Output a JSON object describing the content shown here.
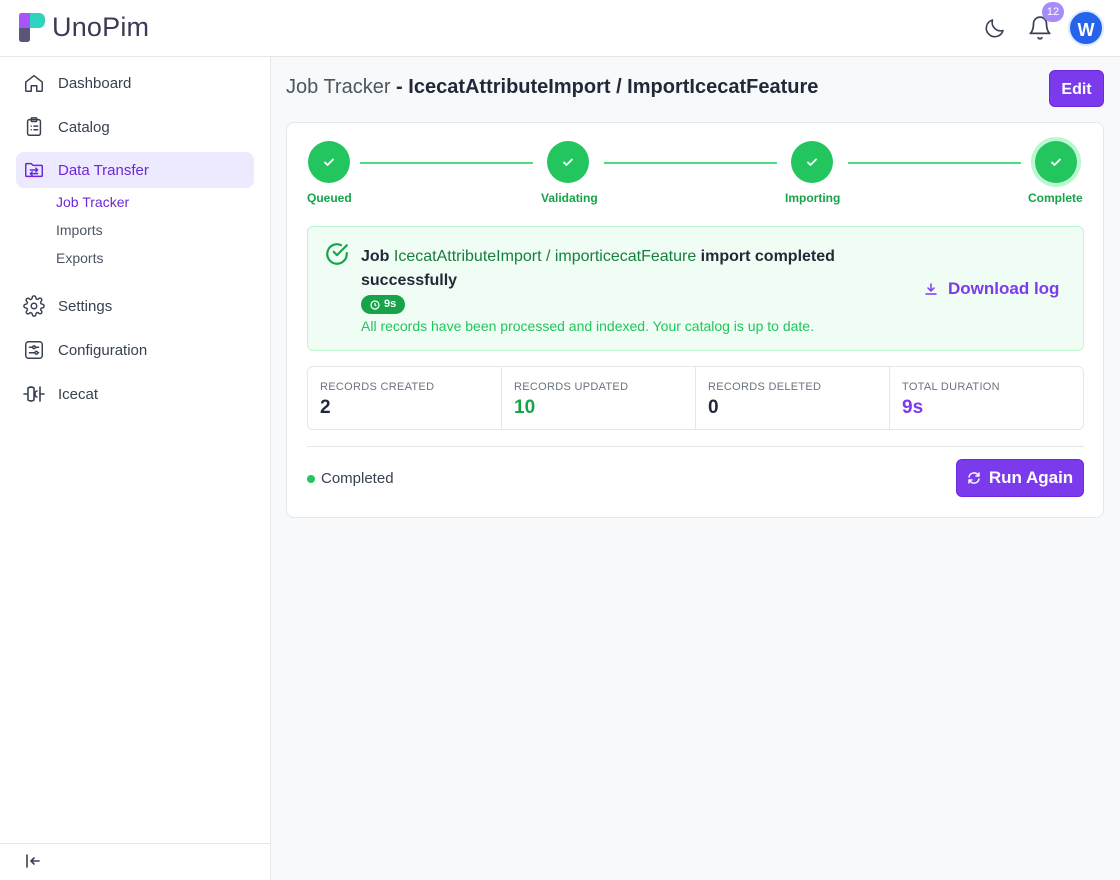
{
  "app": {
    "name": "UnoPim"
  },
  "header": {
    "notifications_count": "12",
    "avatar_initial": "W"
  },
  "sidebar": {
    "items": [
      {
        "label": "Dashboard",
        "icon": "home-icon"
      },
      {
        "label": "Catalog",
        "icon": "clipboard-icon"
      },
      {
        "label": "Data Transfer",
        "icon": "folder-transfer-icon"
      },
      {
        "label": "Settings",
        "icon": "gear-icon"
      },
      {
        "label": "Configuration",
        "icon": "sliders-icon"
      },
      {
        "label": "Icecat",
        "icon": "icecat-icon"
      }
    ],
    "subitems": [
      {
        "label": "Job Tracker"
      },
      {
        "label": "Imports"
      },
      {
        "label": "Exports"
      }
    ]
  },
  "page": {
    "title_prefix": "Job Tracker",
    "title_sep": " - ",
    "title_job": "IcecatAttributeImport / ImportIcecatFeature",
    "edit_label": "Edit"
  },
  "steps": [
    {
      "label": "Queued"
    },
    {
      "label": "Validating"
    },
    {
      "label": "Importing"
    },
    {
      "label": "Complete"
    }
  ],
  "result": {
    "msg_prefix": "Job ",
    "job_name": "IcecatAttributeImport / importicecatFeature",
    "msg_suffix": " import completed successfully",
    "duration": "9s",
    "subtext": "All records have been processed and indexed. Your catalog is up to date.",
    "download_label": "Download log"
  },
  "stats": [
    {
      "label": "Records Created",
      "value": "2"
    },
    {
      "label": "Records Updated",
      "value": "10"
    },
    {
      "label": "Records Deleted",
      "value": "0"
    },
    {
      "label": "Total Duration",
      "value": "9s"
    }
  ],
  "footer": {
    "status": "Completed",
    "run_again_label": "Run Again"
  },
  "colors": {
    "accent": "#7c3aed",
    "success": "#22c55e"
  }
}
